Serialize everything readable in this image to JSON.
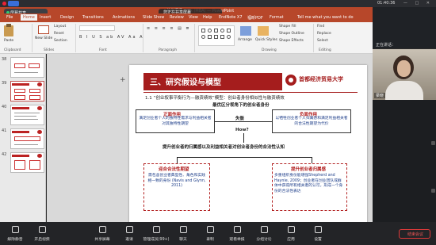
{
  "meeting": {
    "time": "01:40:36",
    "share_status": "屏幕共享",
    "overlay_text": "您正在共享屏幕",
    "window_controls": "— □ ✕",
    "leave_label": "结束会议",
    "video_header": "正在讲话：",
    "participant_name": "梁晓"
  },
  "ppt": {
    "title": "某份汇报.pptx (MBA) — PowerPoint",
    "tabs": [
      "File",
      "Home",
      "Insert",
      "Design",
      "Transitions",
      "Animations",
      "Slide Show",
      "Review",
      "View",
      "Help",
      "EndNote X7",
      "福昕PDF",
      "Format"
    ],
    "active_tab": "Home",
    "tell_me": "Tell me what you want to do",
    "ribbon": {
      "paste": "Paste",
      "new_slide": "New Slide",
      "layout": "Layout",
      "reset": "Reset",
      "section": "Section",
      "clipboard": "Clipboard",
      "slides": "Slides",
      "font": "Font",
      "paragraph": "Paragraph",
      "drawing": "Drawing",
      "arrange": "Arrange",
      "quick_styles": "Quick Styles",
      "shape_fill": "Shape Fill",
      "shape_outline": "Shape Outline",
      "shape_effects": "Shape Effects",
      "find": "Find",
      "replace": "Replace",
      "select": "Select",
      "editing": "Editing",
      "font_format_row": "B I U S ab AV Aa A",
      "paragraph_format_row": "≡ ≡ ≡ ≡ ▤ ≣"
    },
    "thumb_numbers": [
      "38",
      "39",
      "40",
      "41",
      "42"
    ]
  },
  "slide": {
    "banner": "三、研究假设与模型",
    "university": "首都经济贸易大学",
    "subtitle": "1.1 “创业叙事平衡行为—融资绩效”模型：创业者身份相似性与融资绩效",
    "subtitle2": "最优区分视角下的创业者身份",
    "left_box_title": "正面作用",
    "left_box_body": "满足创业者个人的独特性需求与利益相关者对其独特性期望",
    "right_box_title": "负面作用",
    "right_box_body": "以牺牲创业者个人归属感和满足利益相关者的合法性期望为代价",
    "balance_label": "失衡",
    "how_label": "How?",
    "bold_line": "提升创业者的归属感以及利益相关者对创业者身份的合法性认知",
    "bottom_left_title": "迎合合法性期望",
    "bottom_left_body": "需包含创业者典型性、角色和实践相一致的身份 (Navis and Glynn, 2011)",
    "bottom_right_title": "提升创业者归属感",
    "bottom_right_body": "多重组织身份能增强Shepherd and Haynie, 2009；创业者在创业团队或群体中获得所有相关者的认可，形成一个身份的合法性表达"
  },
  "toolbar": {
    "items": [
      "解除静音",
      "开启视频",
      "共享屏幕",
      "邀请",
      "管理成员(99+)",
      "聊天",
      "录制",
      "观看举报",
      "分组讨论",
      "应用",
      "设置"
    ]
  }
}
